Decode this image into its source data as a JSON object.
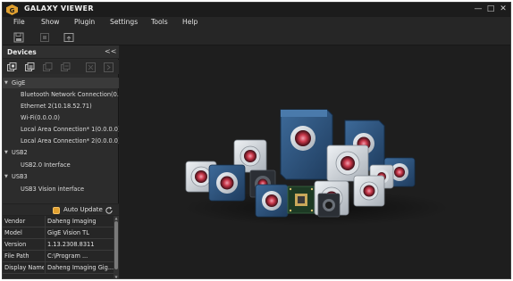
{
  "window": {
    "title": "GALAXY VIEWER",
    "min_symbol": "—",
    "max_symbol": "□",
    "close_symbol": "✕"
  },
  "menu": [
    "File",
    "Show",
    "Plugin",
    "Settings",
    "Tools",
    "Help"
  ],
  "devices": {
    "title": "Devices",
    "collapse_symbol": "<<",
    "tree": [
      {
        "label": "GigE",
        "level": 0,
        "expanded": true,
        "selected": true
      },
      {
        "label": "Bluetooth Network Connection(0...",
        "level": 1
      },
      {
        "label": "Ethernet 2(10.18.52.71)",
        "level": 1
      },
      {
        "label": "Wi-Fi(0.0.0.0)",
        "level": 1
      },
      {
        "label": "Local Area Connection* 1(0.0.0.0)",
        "level": 1
      },
      {
        "label": "Local Area Connection* 2(0.0.0.0)",
        "level": 1
      },
      {
        "label": "USB2",
        "level": 0,
        "expanded": true
      },
      {
        "label": "USB2.0 Interface",
        "level": 1
      },
      {
        "label": "USB3",
        "level": 0,
        "expanded": true
      },
      {
        "label": "USB3 Vision interface",
        "level": 1
      }
    ],
    "auto_update": {
      "label": "Auto Update",
      "checked": true
    }
  },
  "properties": [
    {
      "key": "Vendor",
      "value": "Daheng Imaging"
    },
    {
      "key": "Model",
      "value": "GigE Vision TL"
    },
    {
      "key": "Version",
      "value": "1.13.2308.8311"
    },
    {
      "key": "File Path",
      "value": "C:\\Program ..."
    },
    {
      "key": "Display Name",
      "value": "Daheng Imaging Gig..."
    }
  ],
  "colors": {
    "accent": "#e0a030",
    "background": "#202020",
    "panel": "#2c2c2c",
    "camera_blue": "#2a4d74",
    "camera_silver": "#d8dde2",
    "lens_red": "#c8384a"
  },
  "icons": {
    "toolbar": [
      "save-icon",
      "snapshot-icon",
      "export-icon"
    ],
    "device_toolbar": [
      "open-device-icon",
      "open-all-devices-icon",
      "close-device-icon",
      "close-all-devices-icon",
      "expand-icon",
      "collapse-icon"
    ]
  }
}
